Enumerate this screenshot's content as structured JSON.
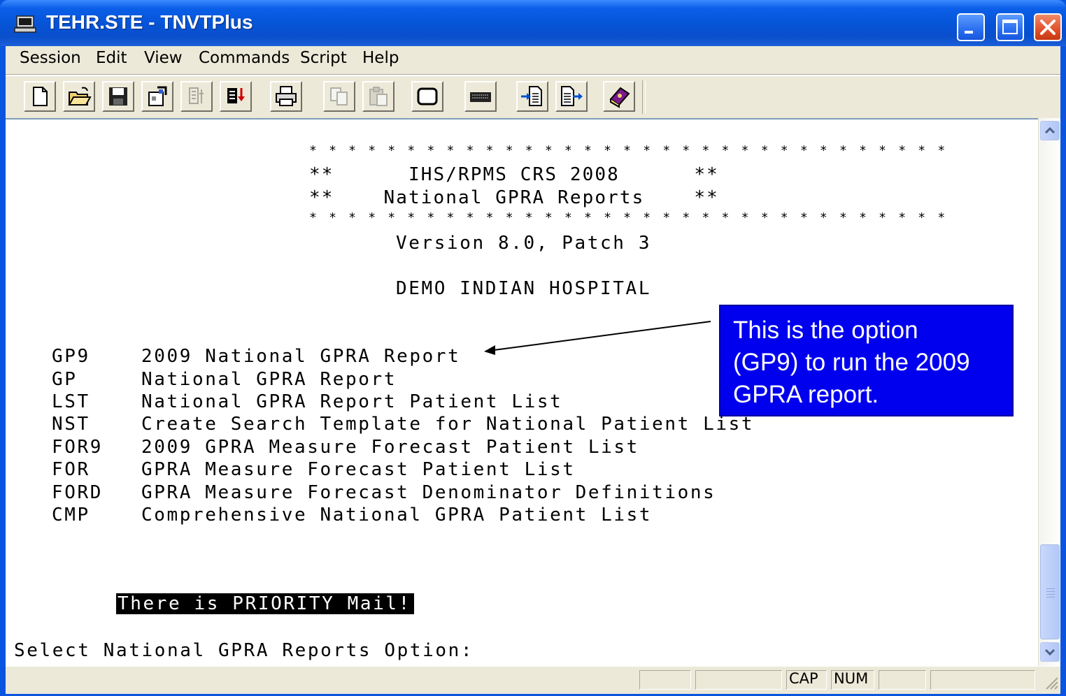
{
  "window": {
    "title": "TEHR.STE - TNVTPlus",
    "icon": "terminal-computer-icon",
    "controls": [
      "minimize-icon",
      "maximize-icon",
      "close-icon"
    ]
  },
  "menu": {
    "items": [
      "Session",
      "Edit",
      "View",
      "Commands",
      "Script",
      "Help"
    ]
  },
  "toolbar": {
    "buttons": [
      "new-document-icon",
      "open-folder-icon",
      "save-disk-icon",
      "properties-icon",
      "disabled-settings-icon",
      "connect-settings-icon",
      "print-icon",
      "copy-icon",
      "paste-icon",
      "screen-icon",
      "keyboard-icon",
      "receive-file-icon",
      "send-file-icon",
      "help-book-icon"
    ]
  },
  "terminal": {
    "banner_stars": "* * * * * * * * * * * * * * * * * * * * * * * * * * * * * * * * *",
    "banner_line1": "**      IHS/RPMS CRS 2008      **",
    "banner_line2": "**    National GPRA Reports    **",
    "version": "Version 8.0, Patch 3",
    "facility": "DEMO INDIAN HOSPITAL",
    "options": [
      {
        "code": "GP9",
        "label": "2009 National GPRA Report"
      },
      {
        "code": "GP",
        "label": "National GPRA Report"
      },
      {
        "code": "LST",
        "label": "National GPRA Report Patient List"
      },
      {
        "code": "NST",
        "label": "Create Search Template for National Patient List"
      },
      {
        "code": "FOR9",
        "label": "2009 GPRA Measure Forecast Patient List"
      },
      {
        "code": "FOR",
        "label": "GPRA Measure Forecast Patient List"
      },
      {
        "code": "FORD",
        "label": "GPRA Measure Forecast Denominator Definitions"
      },
      {
        "code": "CMP",
        "label": "Comprehensive National GPRA Patient List"
      }
    ],
    "priority_message": "There is PRIORITY Mail!",
    "prompt": "Select National GPRA Reports Option:"
  },
  "statusbar": {
    "cap": "CAP",
    "num": "NUM"
  },
  "callout": {
    "lines": [
      "This is the option",
      "(GP9) to run the 2009",
      "GPRA report."
    ],
    "background": "#0000ee"
  }
}
